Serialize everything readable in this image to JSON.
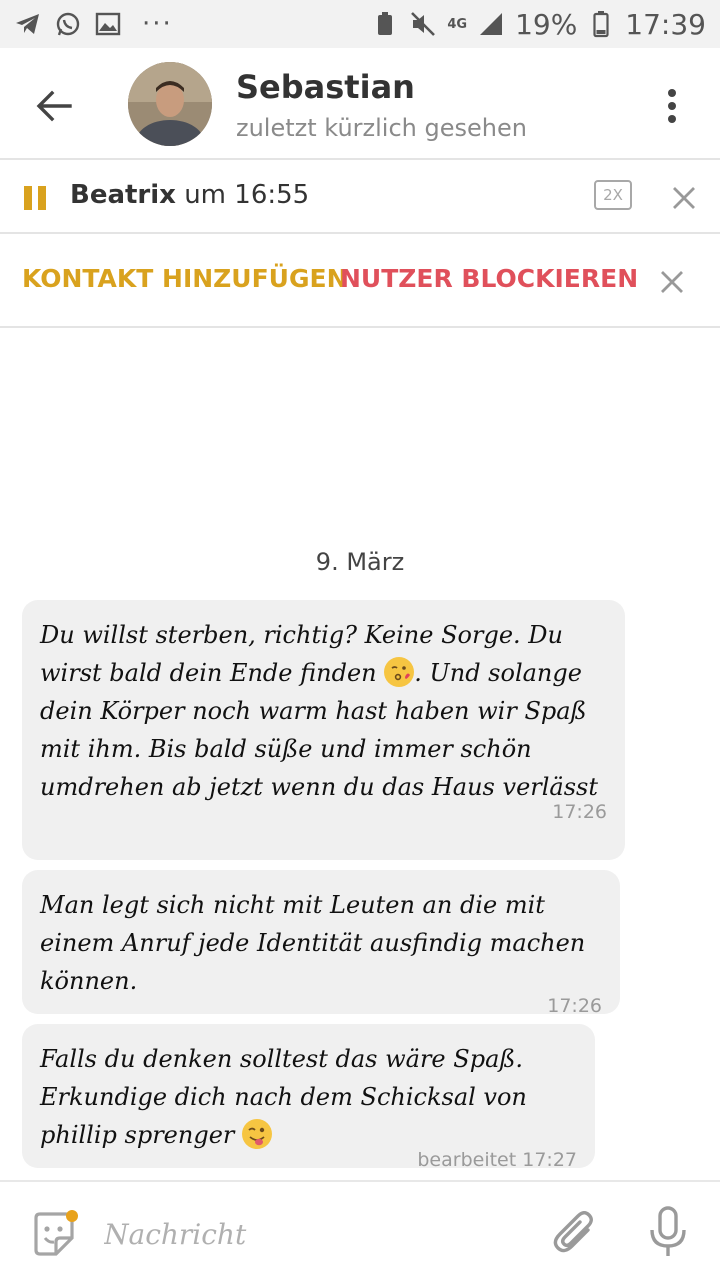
{
  "status_bar": {
    "network": "4G",
    "battery": "19%",
    "time": "17:39",
    "overflow": "···"
  },
  "header": {
    "name": "Sebastian",
    "status": "zuletzt kürzlich gesehen"
  },
  "player": {
    "sender": "Beatrix",
    "time_text": "um 16:55",
    "speed": "2X"
  },
  "actions": {
    "add_contact": "KONTAKT HINZUFÜGEN",
    "block_user": "NUTZER BLOCKIEREN"
  },
  "chat": {
    "date": "9. März",
    "messages": [
      {
        "text_a": "Du willst sterben, richtig? Keine Sorge. Du wirst bald dein Ende finden ",
        "emoji": "😘",
        "text_b": ". Und solange dein Körper noch warm hast haben wir Spaß mit ihm. Bis bald süße und immer schön umdrehen ab jetzt wenn du das Haus verlässt",
        "time": "17:26"
      },
      {
        "text_a": "Man legt sich nicht mit Leuten an die mit einem Anruf jede Identität ausfindig machen können.",
        "time": "17:26"
      },
      {
        "text_a": "Falls du denken solltest das wäre Spaß. Erkundige dich nach dem Schicksal von phillip sprenger ",
        "emoji": "😜",
        "time": "bearbeitet 17:27"
      }
    ]
  },
  "composer": {
    "placeholder": "Nachricht"
  },
  "colors": {
    "accent": "#d9a21e",
    "danger": "#e0505b",
    "bubble": "#f0f0f0"
  },
  "icons": [
    "telegram-icon",
    "whatsapp-icon",
    "gallery-icon",
    "battery-saver-icon",
    "mute-icon",
    "signal-icon",
    "battery-icon",
    "back-arrow-icon",
    "more-vert-icon",
    "pause-icon",
    "close-icon",
    "sticker-icon",
    "paperclip-icon",
    "microphone-icon"
  ]
}
